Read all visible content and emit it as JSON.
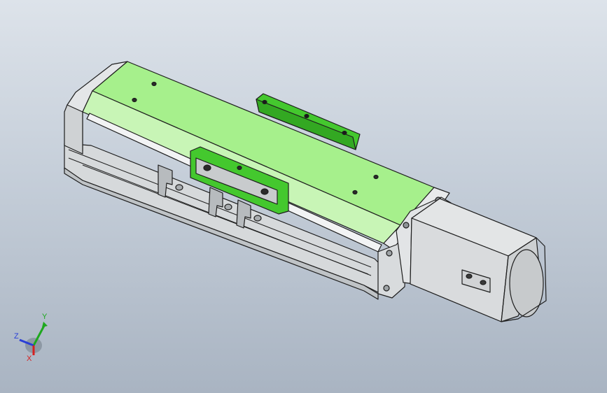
{
  "viewport": {
    "background_top": "#dde3ea",
    "background_bottom": "#a9b4c2"
  },
  "model": {
    "body_color": "#d4d7d9",
    "cover_color": "#a6f08c",
    "bracket_color": "#44c82e",
    "motor_color": "#c9ccce",
    "edge_color": "#1e1e1e"
  },
  "triad": {
    "x_label": "X",
    "y_label": "Y",
    "z_label": "Z",
    "x_color": "#d62020",
    "y_color": "#1ea81e",
    "z_color": "#2a3fd6"
  }
}
